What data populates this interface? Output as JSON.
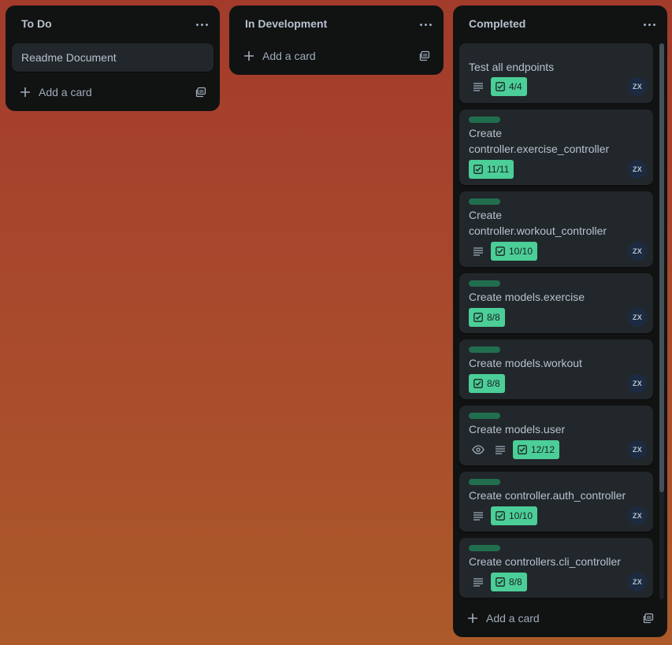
{
  "lists": {
    "todo": {
      "title": "To Do",
      "cards": [
        {
          "title": "Readme Document"
        }
      ],
      "add_label": "Add a card"
    },
    "indev": {
      "title": "In Development",
      "add_label": "Add a card"
    },
    "completed": {
      "title": "Completed",
      "add_label": "Add a card",
      "cards": [
        {
          "title": "Test all endpoints",
          "label": false,
          "description": true,
          "watching": false,
          "checklist": "4/4",
          "member": "ZX"
        },
        {
          "title_line1": "Create",
          "title_line2": "controller.exercise_controller",
          "label": true,
          "description": false,
          "watching": false,
          "checklist": "11/11",
          "member": "ZX"
        },
        {
          "title_line1": "Create",
          "title_line2": "controller.workout_controller",
          "label": true,
          "description": true,
          "watching": false,
          "checklist": "10/10",
          "member": "ZX"
        },
        {
          "title": "Create models.exercise",
          "label": true,
          "description": false,
          "watching": false,
          "checklist": "8/8",
          "member": "ZX"
        },
        {
          "title": "Create models.workout",
          "label": true,
          "description": false,
          "watching": false,
          "checklist": "8/8",
          "member": "ZX"
        },
        {
          "title": "Create models.user",
          "label": true,
          "description": true,
          "watching": true,
          "checklist": "12/12",
          "member": "ZX"
        },
        {
          "title": "Create controller.auth_controller",
          "label": true,
          "description": true,
          "watching": false,
          "checklist": "10/10",
          "member": "ZX"
        },
        {
          "title": "Create controllers.cli_controller",
          "label": true,
          "description": true,
          "watching": false,
          "checklist": "8/8",
          "member": "ZX"
        }
      ]
    }
  },
  "colors": {
    "label_green": "#216e4e",
    "checklist_complete": "#4bce97",
    "list_bg": "#111212",
    "card_bg": "#22272b"
  },
  "icons": {
    "list_menu": "ellipsis-icon",
    "add": "plus-icon",
    "template": "card-template-icon",
    "description": "description-icon",
    "checklist": "checklist-icon",
    "watch": "eye-icon"
  }
}
